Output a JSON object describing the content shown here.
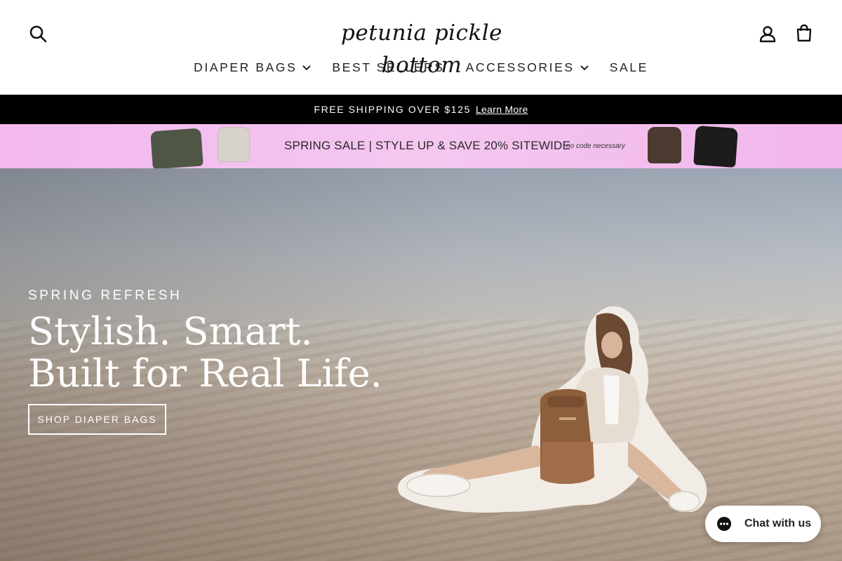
{
  "brand": {
    "logo_text": "petunia pickle bottom"
  },
  "header": {
    "icons": {
      "search": "search-icon",
      "account": "account-icon",
      "cart": "cart-icon"
    }
  },
  "nav": {
    "items": [
      {
        "label": "DIAPER BAGS",
        "has_dropdown": true
      },
      {
        "label": "BEST SELLERS",
        "has_dropdown": false
      },
      {
        "label": "ACCESSORIES",
        "has_dropdown": true
      },
      {
        "label": "SALE",
        "has_dropdown": false
      }
    ]
  },
  "announcement": {
    "text": "FREE SHIPPING OVER $125",
    "link": "Learn More"
  },
  "promo": {
    "text": "SPRING SALE  |  STYLE UP & SAVE 20% SITEWIDE",
    "note": "no code necessary",
    "background": "#f4c3ef"
  },
  "hero": {
    "eyebrow": "SPRING REFRESH",
    "title_line1": "Stylish. Smart.",
    "title_line2": "Built for Real Life.",
    "cta": "SHOP DIAPER BAGS"
  },
  "chat": {
    "label": "Chat with us",
    "icon": "chat-bubble-icon"
  }
}
